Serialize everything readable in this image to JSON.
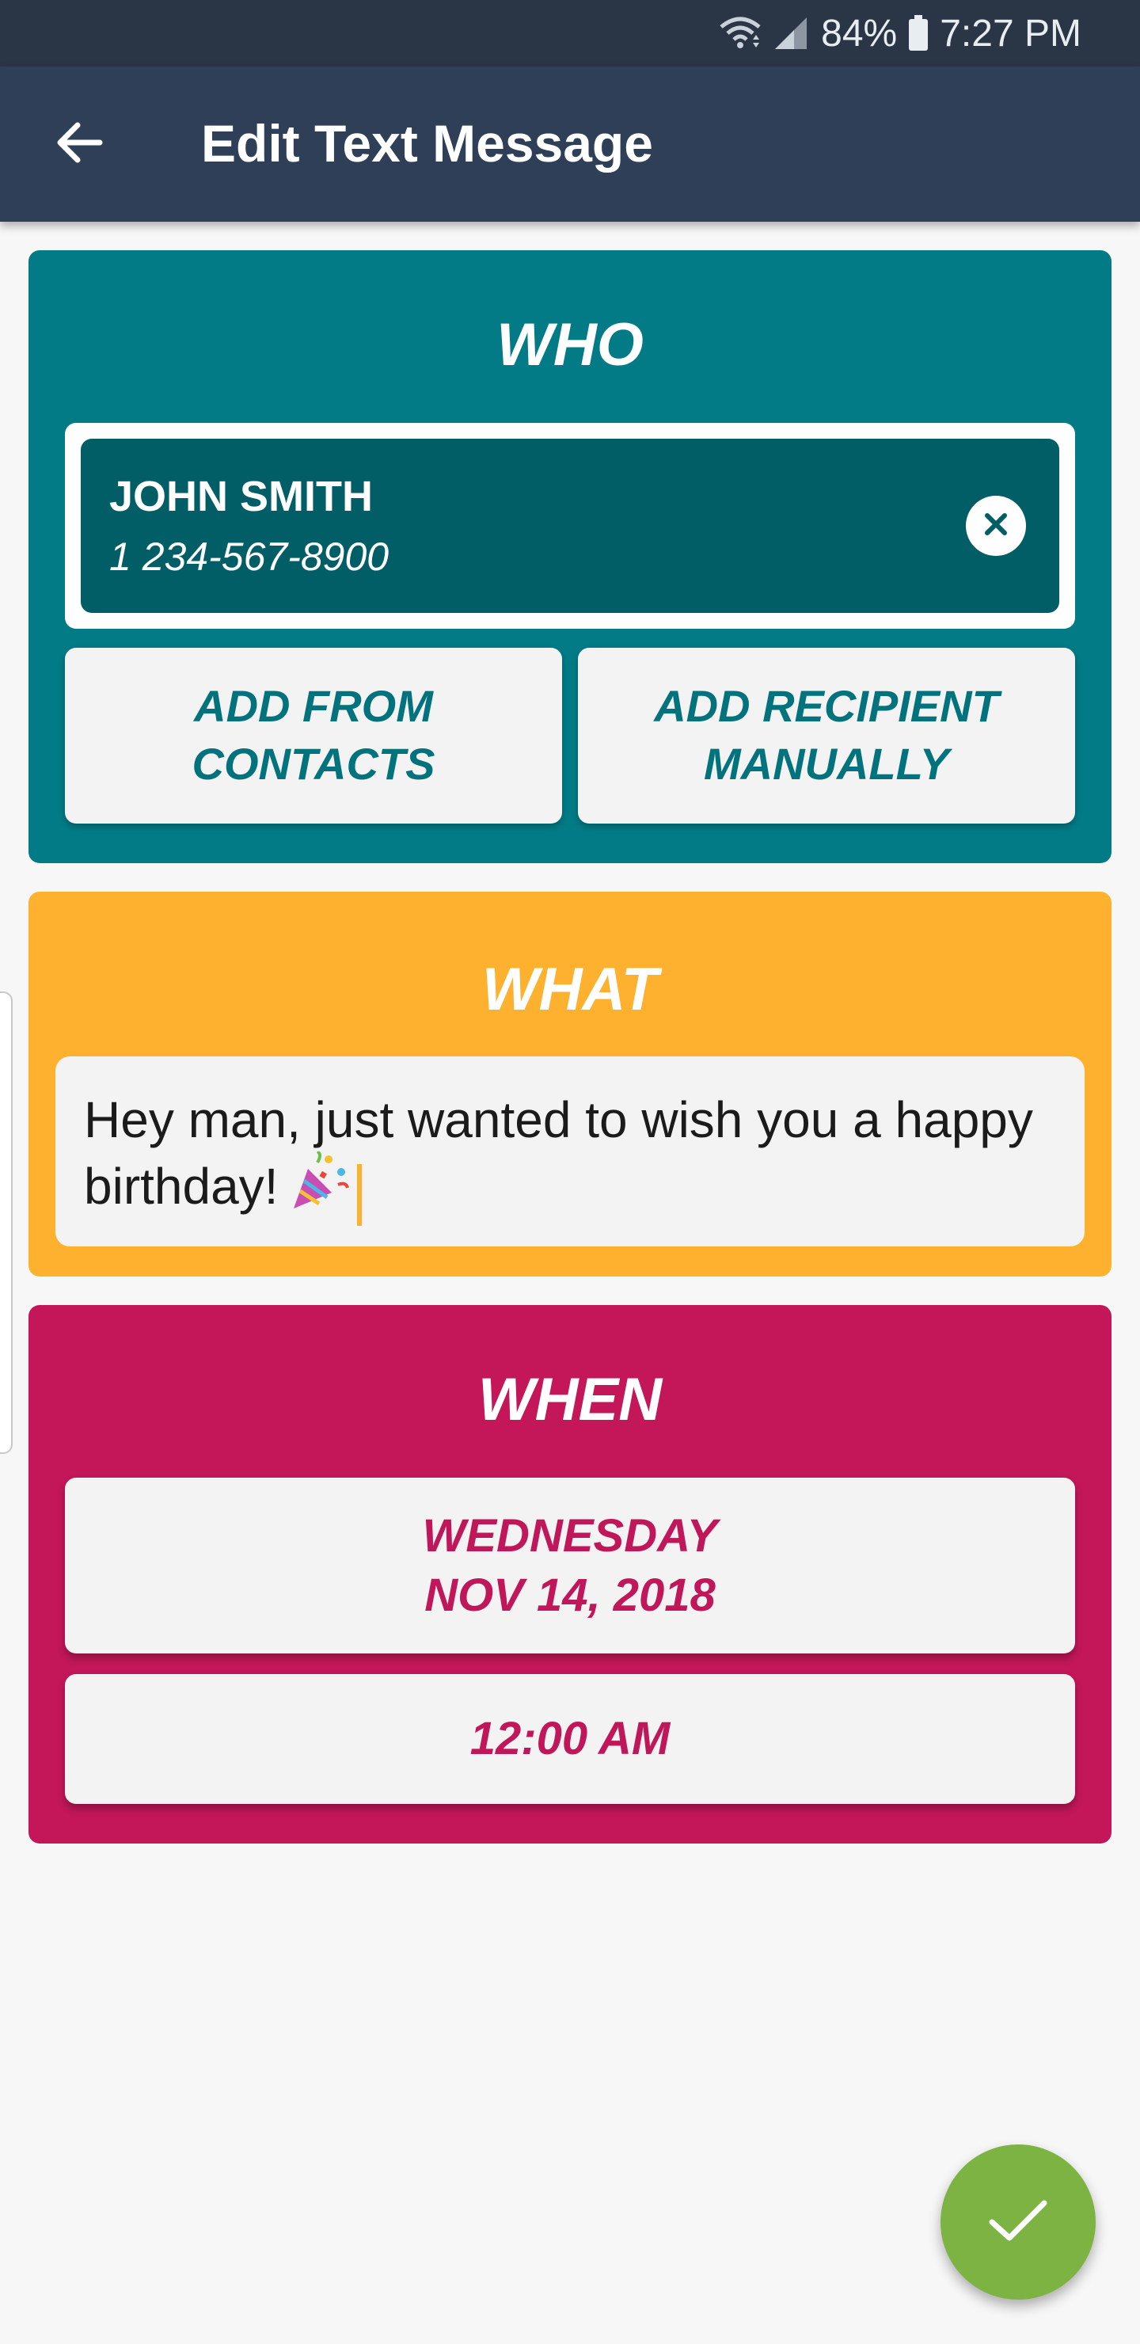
{
  "status_bar": {
    "battery": "84%",
    "time": "7:27 PM",
    "icons": [
      "wifi-icon",
      "signal-icon",
      "battery-icon"
    ]
  },
  "app_bar": {
    "title": "Edit Text Message",
    "back_icon": "arrow-back-icon"
  },
  "who": {
    "title": "WHO",
    "recipient": {
      "name": "JOHN SMITH",
      "number": "1 234-567-8900",
      "remove_icon": "close-circle-icon"
    },
    "add_from_contacts_label": "ADD FROM\nCONTACTS",
    "add_manually_label": "ADD RECIPIENT\nMANUALLY",
    "color": "#027b86"
  },
  "what": {
    "title": "WHAT",
    "message": "Hey man, just wanted to wish you a happy birthday!",
    "emoji": "party-popper-icon",
    "color": "#fdb12f"
  },
  "when": {
    "title": "WHEN",
    "day": "WEDNESDAY",
    "date": "NOV 14, 2018",
    "time": "12:00 AM",
    "color": "#c3175a"
  },
  "fab": {
    "icon": "checkmark-icon",
    "color": "#7cb342"
  }
}
